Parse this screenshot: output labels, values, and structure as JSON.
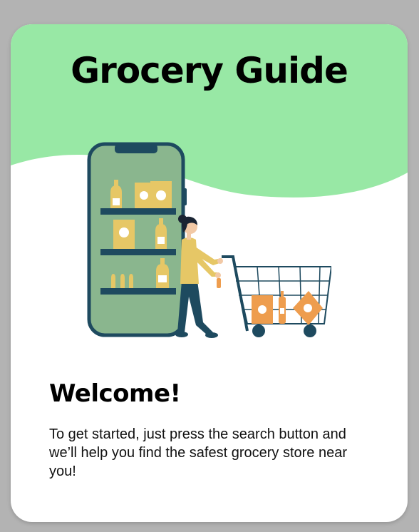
{
  "header": {
    "title": "Grocery Guide"
  },
  "welcome": {
    "heading": "Welcome!",
    "body": "To get started, just press the search button and we’ll help you find the safest grocery store near you!"
  },
  "illustration": {
    "icon": "shopping-woman-with-cart-illustration"
  },
  "colors": {
    "header_green": "#98e8a5",
    "phone_green": "#8ab68e",
    "dark_teal": "#1e4a5f",
    "mustard": "#e6c766",
    "orange": "#ee9d4e",
    "background": "#b3b3b3"
  }
}
